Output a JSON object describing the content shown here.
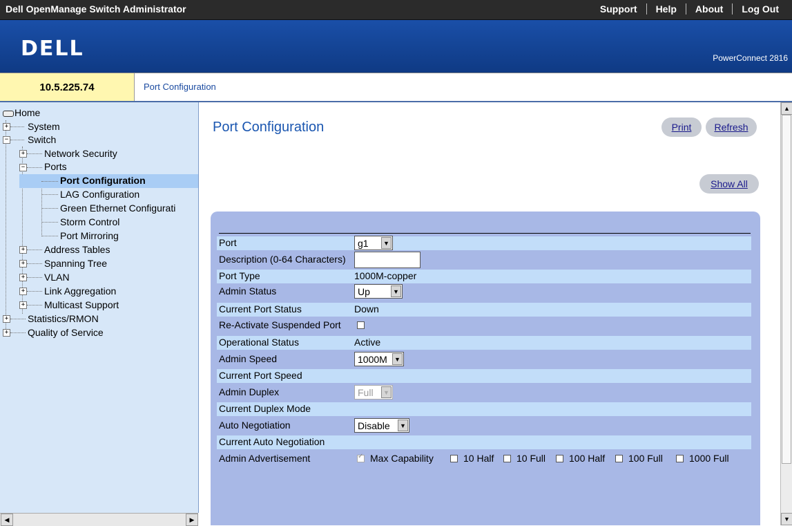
{
  "app": {
    "title": "Dell OpenManage Switch Administrator"
  },
  "top_links": {
    "support": "Support",
    "help": "Help",
    "about": "About",
    "logout": "Log Out"
  },
  "header": {
    "logo": "DELL",
    "model": "PowerConnect 2816"
  },
  "ip": "10.5.225.74",
  "breadcrumb": "Port Configuration",
  "sidebar": {
    "items": [
      "Home",
      "System",
      "Switch",
      "Network Security",
      "Ports",
      "Port Configuration",
      "LAG Configuration",
      "Green Ethernet Configurati",
      "Storm Control",
      "Port Mirroring",
      "Address Tables",
      "Spanning Tree",
      "VLAN",
      "Link Aggregation",
      "Multicast Support",
      "Statistics/RMON",
      "Quality of Service"
    ]
  },
  "page": {
    "title": "Port Configuration",
    "print_button": "Print",
    "refresh_button": "Refresh",
    "show_all_button": "Show All"
  },
  "form": {
    "labels": {
      "port": "Port",
      "description": "Description (0-64 Characters)",
      "port_type": "Port Type",
      "admin_status": "Admin Status",
      "current_port_status": "Current Port Status",
      "reactivate": "Re-Activate Suspended Port",
      "operational_status": "Operational Status",
      "admin_speed": "Admin Speed",
      "current_port_speed": "Current Port Speed",
      "admin_duplex": "Admin Duplex",
      "current_duplex_mode": "Current Duplex Mode",
      "auto_negotiation": "Auto Negotiation",
      "current_auto_negotiation": "Current Auto Negotiation",
      "admin_advertisement": "Admin Advertisement"
    },
    "values": {
      "port": "g1",
      "description": "",
      "port_type": "1000M-copper",
      "admin_status": "Up",
      "current_port_status": "Down",
      "reactivate_checked": false,
      "operational_status": "Active",
      "admin_speed": "1000M",
      "admin_duplex": "Full",
      "auto_negotiation": "Disable"
    },
    "advertisement": {
      "max_capability": "Max Capability",
      "half10": "10 Half",
      "full10": "10 Full",
      "half100": "100 Half",
      "full100": "100 Full",
      "full1000": "1000 Full"
    }
  }
}
